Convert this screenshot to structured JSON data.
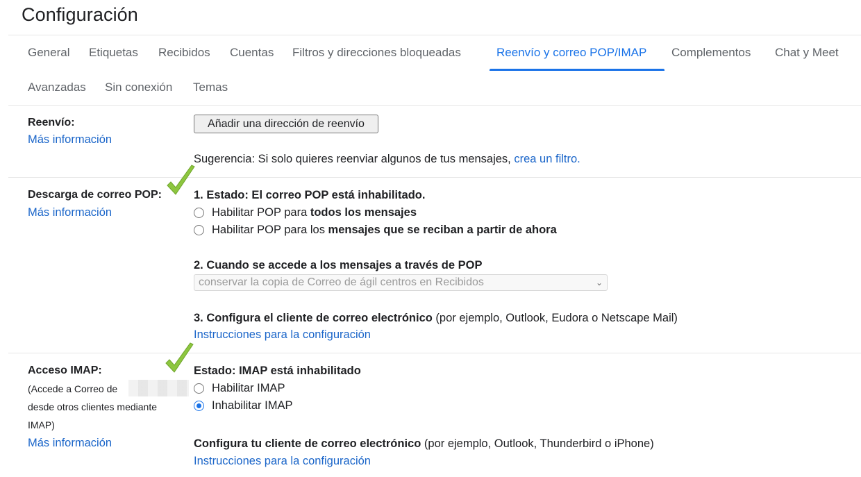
{
  "page": {
    "title": "Configuración"
  },
  "tabs": [
    {
      "label": "General",
      "active": false
    },
    {
      "label": "Etiquetas",
      "active": false
    },
    {
      "label": "Recibidos",
      "active": false
    },
    {
      "label": "Cuentas",
      "active": false
    },
    {
      "label": "Filtros y direcciones bloqueadas",
      "active": false
    },
    {
      "label": "Reenvío y correo POP/IMAP",
      "active": true
    },
    {
      "label": "Complementos",
      "active": false
    },
    {
      "label": "Chat y Meet",
      "active": false
    },
    {
      "label": "Avanzadas",
      "active": false
    },
    {
      "label": "Sin conexión",
      "active": false
    },
    {
      "label": "Temas",
      "active": false
    }
  ],
  "colors": {
    "accent": "#1a73e8",
    "link": "#1a65c9",
    "checkmark": "#8dc63f"
  },
  "forwarding": {
    "label": "Reenvío:",
    "more_info": "Más información",
    "add_button": "Añadir una dirección de reenvío",
    "tip_prefix": "Sugerencia: Si solo quieres reenviar algunos de tus mensajes, ",
    "tip_link": "crea un filtro."
  },
  "pop": {
    "label": "Descarga de correo POP:",
    "more_info": "Más información",
    "status": "1. Estado: El correo POP está inhabilitado.",
    "option_all_prefix": "Habilitar POP para ",
    "option_all_bold": "todos los mensajes",
    "option_from_now_prefix": "Habilitar POP para los ",
    "option_from_now_bold": "mensajes que se reciban a partir de ahora",
    "access_heading": "2. Cuando se accede a los mensajes a través de POP",
    "access_select": "conservar la copia de Correo de ágil centros en Recibidos",
    "client_heading": "3. Configura el cliente de correo electrónico",
    "client_examples": " (por ejemplo, Outlook, Eudora o Netscape Mail)",
    "instructions_link": "Instrucciones para la configuración"
  },
  "imap": {
    "label": "Acceso IMAP:",
    "desc_line1": "(Accede a Correo de",
    "desc_line2": "desde otros clientes mediante",
    "desc_line3": "IMAP)",
    "more_info": "Más información",
    "status": "Estado: IMAP está inhabilitado",
    "enable": "Habilitar IMAP",
    "disable": "Inhabilitar IMAP",
    "selected": "disable",
    "client_heading": "Configura tu cliente de correo electrónico",
    "client_examples": " (por ejemplo, Outlook, Thunderbird o iPhone)",
    "instructions_link": "Instrucciones para la configuración"
  }
}
